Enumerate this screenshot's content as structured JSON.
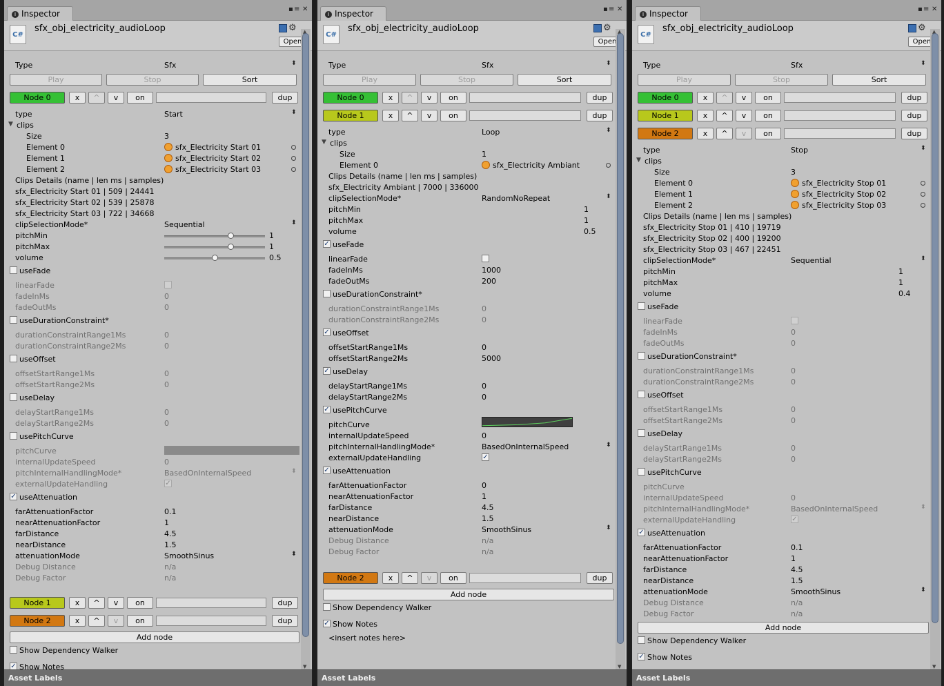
{
  "tab_title": "Inspector",
  "info_icon": "info-icon",
  "lock_icon": "lock-icon",
  "menu_icon": "menu-icon",
  "close_icon": "close-icon",
  "file_title": "sfx_obj_electricity_audioLoop",
  "csharp_label": "C#",
  "help_icon": "help-book-icon",
  "gear_icon": "gear-icon",
  "open_label": "Open",
  "type_label": "Type",
  "type_value": "Sfx",
  "play_label": "Play",
  "stop_label": "Stop",
  "sort_label": "Sort",
  "node_labels": [
    "Node 0",
    "Node 1",
    "Node 2"
  ],
  "x_label": "x",
  "up_label": "^",
  "down_label": "v",
  "on_label": "on",
  "dup_label": "dup",
  "add_node_label": "Add node",
  "show_dependency_label": "Show Dependency Walker",
  "show_notes_label": "Show Notes",
  "notes_text": "<insert notes here>",
  "asset_labels": "Asset Labels",
  "colors": {
    "node0": "#35c035",
    "node1": "#b8c81c",
    "node2": "#d27812"
  },
  "fields": {
    "type": "type",
    "clips": "clips",
    "size": "Size",
    "element_0": "Element 0",
    "element_1": "Element 1",
    "element_2": "Element 2",
    "clips_details": "Clips Details (name | len ms | samples)",
    "clip_selection": "clipSelectionMode*",
    "pitch_min": "pitchMin",
    "pitch_max": "pitchMax",
    "volume": "volume",
    "use_fade": "useFade",
    "linear_fade": "linearFade",
    "fade_in": "fadeInMs",
    "fade_out": "fadeOutMs",
    "use_duration": "useDurationConstraint*",
    "dur1": "durationConstraintRange1Ms",
    "dur2": "durationConstraintRange2Ms",
    "use_offset": "useOffset",
    "off1": "offsetStartRange1Ms",
    "off2": "offsetStartRange2Ms",
    "use_delay": "useDelay",
    "del1": "delayStartRange1Ms",
    "del2": "delayStartRange2Ms",
    "use_pitch_curve": "usePitchCurve",
    "pitch_curve": "pitchCurve",
    "internal_update": "internalUpdateSpeed",
    "pitch_handling": "pitchInternalHandlingMode*",
    "external_update": "externalUpdateHandling",
    "use_attenuation": "useAttenuation",
    "far_att": "farAttenuationFactor",
    "near_att": "nearAttenuationFactor",
    "far_dist": "farDistance",
    "near_dist": "nearDistance",
    "att_mode": "attenuationMode",
    "debug_dist": "Debug Distance",
    "debug_factor": "Debug Factor"
  },
  "p1": {
    "type_val": "Start",
    "size": "3",
    "elements": [
      "sfx_Electricity Start 01",
      "sfx_Electricity Start 02",
      "sfx_Electricity Start 03"
    ],
    "details": [
      "sfx_Electricity Start 01 | 509 | 24441",
      "sfx_Electricity Start 02 | 539 | 25878",
      "sfx_Electricity Start 03 | 722 | 34668"
    ],
    "clip_selection": "Sequential",
    "pitch_min": "1",
    "pitch_max": "1",
    "volume": "0.5",
    "fade_in": "0",
    "fade_out": "0",
    "dur1": "0",
    "dur2": "0",
    "off1": "0",
    "off2": "0",
    "del1": "0",
    "del2": "0",
    "internal_update": "0",
    "pitch_handling": "BasedOnInternalSpeed",
    "far_att": "0.1",
    "near_att": "1",
    "far_dist": "4.5",
    "near_dist": "1.5",
    "att_mode": "SmoothSinus",
    "debug_dist": "n/a",
    "debug_factor": "n/a"
  },
  "p2": {
    "type_val": "Loop",
    "size": "1",
    "elements": [
      "sfx_Electricity Ambiant"
    ],
    "details": [
      "sfx_Electricity Ambiant | 7000 | 336000"
    ],
    "clip_selection": "RandomNoRepeat",
    "pitch_min": "1",
    "pitch_max": "1",
    "volume": "0.5",
    "fade_in": "1000",
    "fade_out": "200",
    "dur1": "0",
    "dur2": "0",
    "off1": "0",
    "off2": "5000",
    "del1": "0",
    "del2": "0",
    "internal_update": "0",
    "pitch_handling": "BasedOnInternalSpeed",
    "far_att": "0",
    "near_att": "1",
    "far_dist": "4.5",
    "near_dist": "1.5",
    "att_mode": "SmoothSinus",
    "debug_dist": "n/a",
    "debug_factor": "n/a"
  },
  "p3": {
    "type_val": "Stop",
    "size": "3",
    "elements": [
      "sfx_Electricity Stop 01",
      "sfx_Electricity Stop 02",
      "sfx_Electricity Stop 03"
    ],
    "details": [
      "sfx_Electricity Stop 01 | 410 | 19719",
      "sfx_Electricity Stop 02 | 400 | 19200",
      "sfx_Electricity Stop 03 | 467 | 22451"
    ],
    "clip_selection": "Sequential",
    "pitch_min": "1",
    "pitch_max": "1",
    "volume": "0.4",
    "fade_in": "0",
    "fade_out": "0",
    "dur1": "0",
    "dur2": "0",
    "off1": "0",
    "off2": "0",
    "del1": "0",
    "del2": "0",
    "internal_update": "0",
    "pitch_handling": "BasedOnInternalSpeed",
    "far_att": "0.1",
    "near_att": "1",
    "far_dist": "4.5",
    "near_dist": "1.5",
    "att_mode": "SmoothSinus",
    "debug_dist": "n/a",
    "debug_factor": "n/a"
  }
}
